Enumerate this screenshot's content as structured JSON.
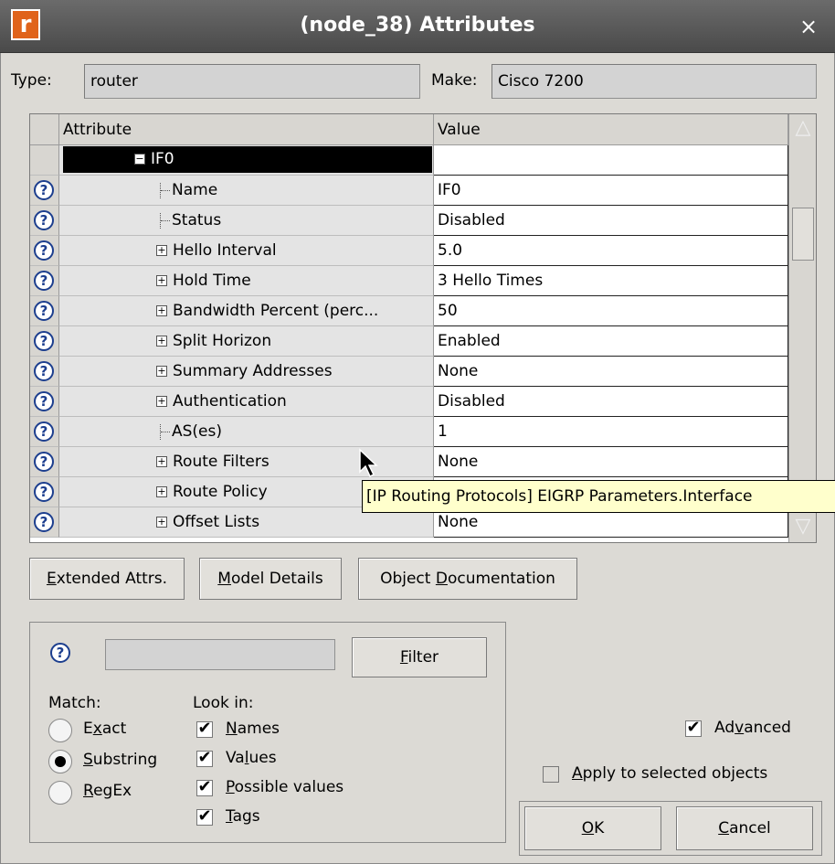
{
  "window": {
    "title": "(node_38) Attributes",
    "app_icon": "r",
    "close_glyph": "×"
  },
  "header": {
    "type_label": "Type:",
    "type_value": "router",
    "make_label": "Make:",
    "make_value": "Cisco 7200"
  },
  "table": {
    "columns": [
      "Attribute",
      "Value"
    ],
    "group": {
      "name": "IF0",
      "expander": "minus"
    },
    "rows": [
      {
        "name": "Name",
        "value": "IF0",
        "kind": "leaf"
      },
      {
        "name": "Status",
        "value": "Disabled",
        "kind": "leaf"
      },
      {
        "name": "Hello Interval",
        "value": "5.0",
        "kind": "expand"
      },
      {
        "name": "Hold Time",
        "value": "3 Hello Times",
        "kind": "expand"
      },
      {
        "name": "Bandwidth Percent (perc...",
        "value": "50",
        "kind": "expand"
      },
      {
        "name": "Split Horizon",
        "value": "Enabled",
        "kind": "expand"
      },
      {
        "name": "Summary Addresses",
        "value": "None",
        "kind": "expand"
      },
      {
        "name": "Authentication",
        "value": "Disabled",
        "kind": "expand"
      },
      {
        "name": "AS(es)",
        "value": "1",
        "kind": "leaf"
      },
      {
        "name": "Route Filters",
        "value": "None",
        "kind": "expand"
      },
      {
        "name": "Route Policy",
        "value": "",
        "kind": "expand"
      },
      {
        "name": "Offset Lists",
        "value": "None",
        "kind": "expand"
      }
    ],
    "tooltip": "[IP Routing Protocols] EIGRP Parameters.Interface"
  },
  "buttons": {
    "extended_pre": "",
    "extended_key": "E",
    "extended_post": "xtended Attrs.",
    "model_pre": "",
    "model_key": "M",
    "model_post": "odel Details",
    "objdoc_pre": "Object ",
    "objdoc_key": "D",
    "objdoc_post": "ocumentation"
  },
  "filter": {
    "input_value": "",
    "button_key": "F",
    "button_post": "ilter",
    "match_label": "Match:",
    "match_options": [
      {
        "pre": "E",
        "key": "x",
        "post": "act",
        "selected": false
      },
      {
        "pre": "",
        "key": "S",
        "post": "ubstring",
        "selected": true
      },
      {
        "pre": "",
        "key": "R",
        "post": "egEx",
        "selected": false
      }
    ],
    "lookin_label": "Look in:",
    "lookin_options": [
      {
        "pre": "",
        "key": "N",
        "post": "ames",
        "checked": true
      },
      {
        "pre": "Va",
        "key": "l",
        "post": "ues",
        "checked": true
      },
      {
        "pre": "",
        "key": "P",
        "post": "ossible values",
        "checked": true
      },
      {
        "pre": "",
        "key": "T",
        "post": "ags",
        "checked": true
      }
    ]
  },
  "options": {
    "advanced_pre": "Ad",
    "advanced_key": "v",
    "advanced_post": "anced",
    "advanced_checked": true,
    "apply_pre": "",
    "apply_key": "A",
    "apply_post": "pply to selected objects",
    "apply_checked": false
  },
  "dialog_buttons": {
    "ok_key": "O",
    "ok_post": "K",
    "cancel_key": "C",
    "cancel_post": "ancel"
  }
}
